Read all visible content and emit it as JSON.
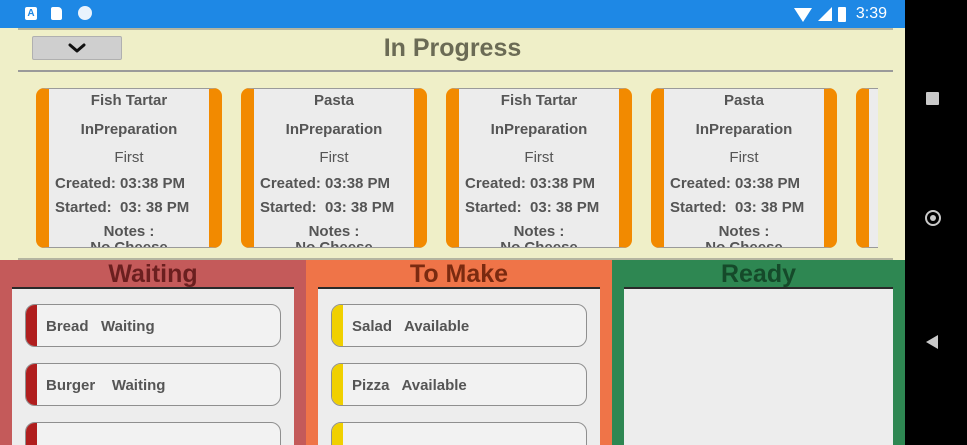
{
  "status_bar": {
    "time": "3:39",
    "left_icons": [
      "app-a-icon",
      "sd-card-icon",
      "sync-circle-icon"
    ],
    "right_icons": [
      "wifi-icon",
      "signal-icon",
      "battery-icon"
    ],
    "app_letter": "A",
    "background": "#1e88e5"
  },
  "in_progress": {
    "title": "In Progress",
    "collapse_icon": "chevron-down-icon",
    "background": "#efefc8",
    "accent": "#f28a00",
    "cards": [
      {
        "dish": "Fish Tartar",
        "state": "InPreparation",
        "course": "First",
        "created": "Created: 03:38 PM",
        "started": "Started:  03: 38 PM",
        "notes_label": "Notes :",
        "notes_value": "No Cheese"
      },
      {
        "dish": "Pasta",
        "state": "InPreparation",
        "course": "First",
        "created": "Created: 03:38 PM",
        "started": "Started:  03: 38 PM",
        "notes_label": "Notes :",
        "notes_value": "No Cheese"
      },
      {
        "dish": "Fish Tartar",
        "state": "InPreparation",
        "course": "First",
        "created": "Created: 03:38 PM",
        "started": "Started:  03: 38 PM",
        "notes_label": "Notes :",
        "notes_value": "No Cheese"
      },
      {
        "dish": "Pasta",
        "state": "InPreparation",
        "course": "First",
        "created": "Created: 03:38 PM",
        "started": "Started:  03: 38 PM",
        "notes_label": "Notes :",
        "notes_value": "No Cheese"
      }
    ]
  },
  "columns": {
    "waiting": {
      "title": "Waiting",
      "title_color": "#6b1f1f",
      "background": "#c45a5a",
      "stripe": "#b01e1e",
      "items": [
        {
          "name": "Bread",
          "status": "Waiting",
          "text": "Bread   Waiting"
        },
        {
          "name": "Burger",
          "status": "Waiting",
          "text": "Burger    Waiting"
        }
      ]
    },
    "to_make": {
      "title": "To Make",
      "title_color": "#7a2a10",
      "background": "#ef7448",
      "stripe": "#f0d000",
      "items": [
        {
          "name": "Salad",
          "status": "Available",
          "text": "Salad   Available"
        },
        {
          "name": "Pizza",
          "status": "Available",
          "text": "Pizza   Available"
        }
      ]
    },
    "ready": {
      "title": "Ready",
      "title_color": "#154a2a",
      "background": "#2e8752",
      "items": []
    }
  },
  "nav_bar": {
    "icons": [
      "recents-square-icon",
      "home-circle-icon",
      "back-triangle-icon"
    ]
  }
}
